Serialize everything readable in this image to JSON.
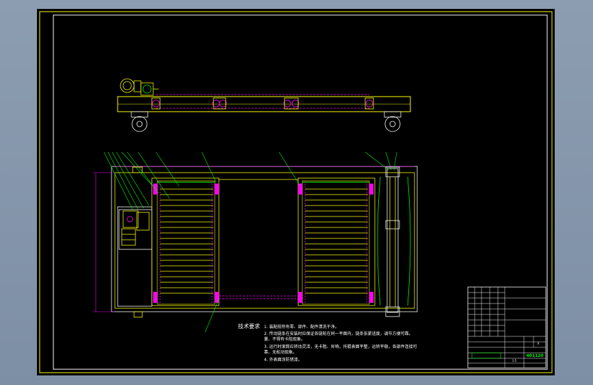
{
  "notes": {
    "title": "技术要求",
    "items": [
      "1. 装配前所有零、部件、配件清洗干净。",
      "2. 传动链条在安装时应保证各链轮在同一平面内，链条张紧适度，调节方便可靠。",
      "   量、不得有卡阻现象。",
      "3. 运行时滚筒应转动灵活，无卡阻、异响，托辊表面平整，运转平稳，各部件连接可",
      "   靠、无松动现象。",
      "4. 外表面涂防锈漆。"
    ]
  },
  "title_block": {
    "drawing_code": "401120",
    "sheet_label": "A",
    "scale_label": "1:5"
  },
  "colors": {
    "frame": "#ffff00",
    "chain": "#ff00ff",
    "leader": "#00ff00",
    "border": "#ffffff"
  }
}
